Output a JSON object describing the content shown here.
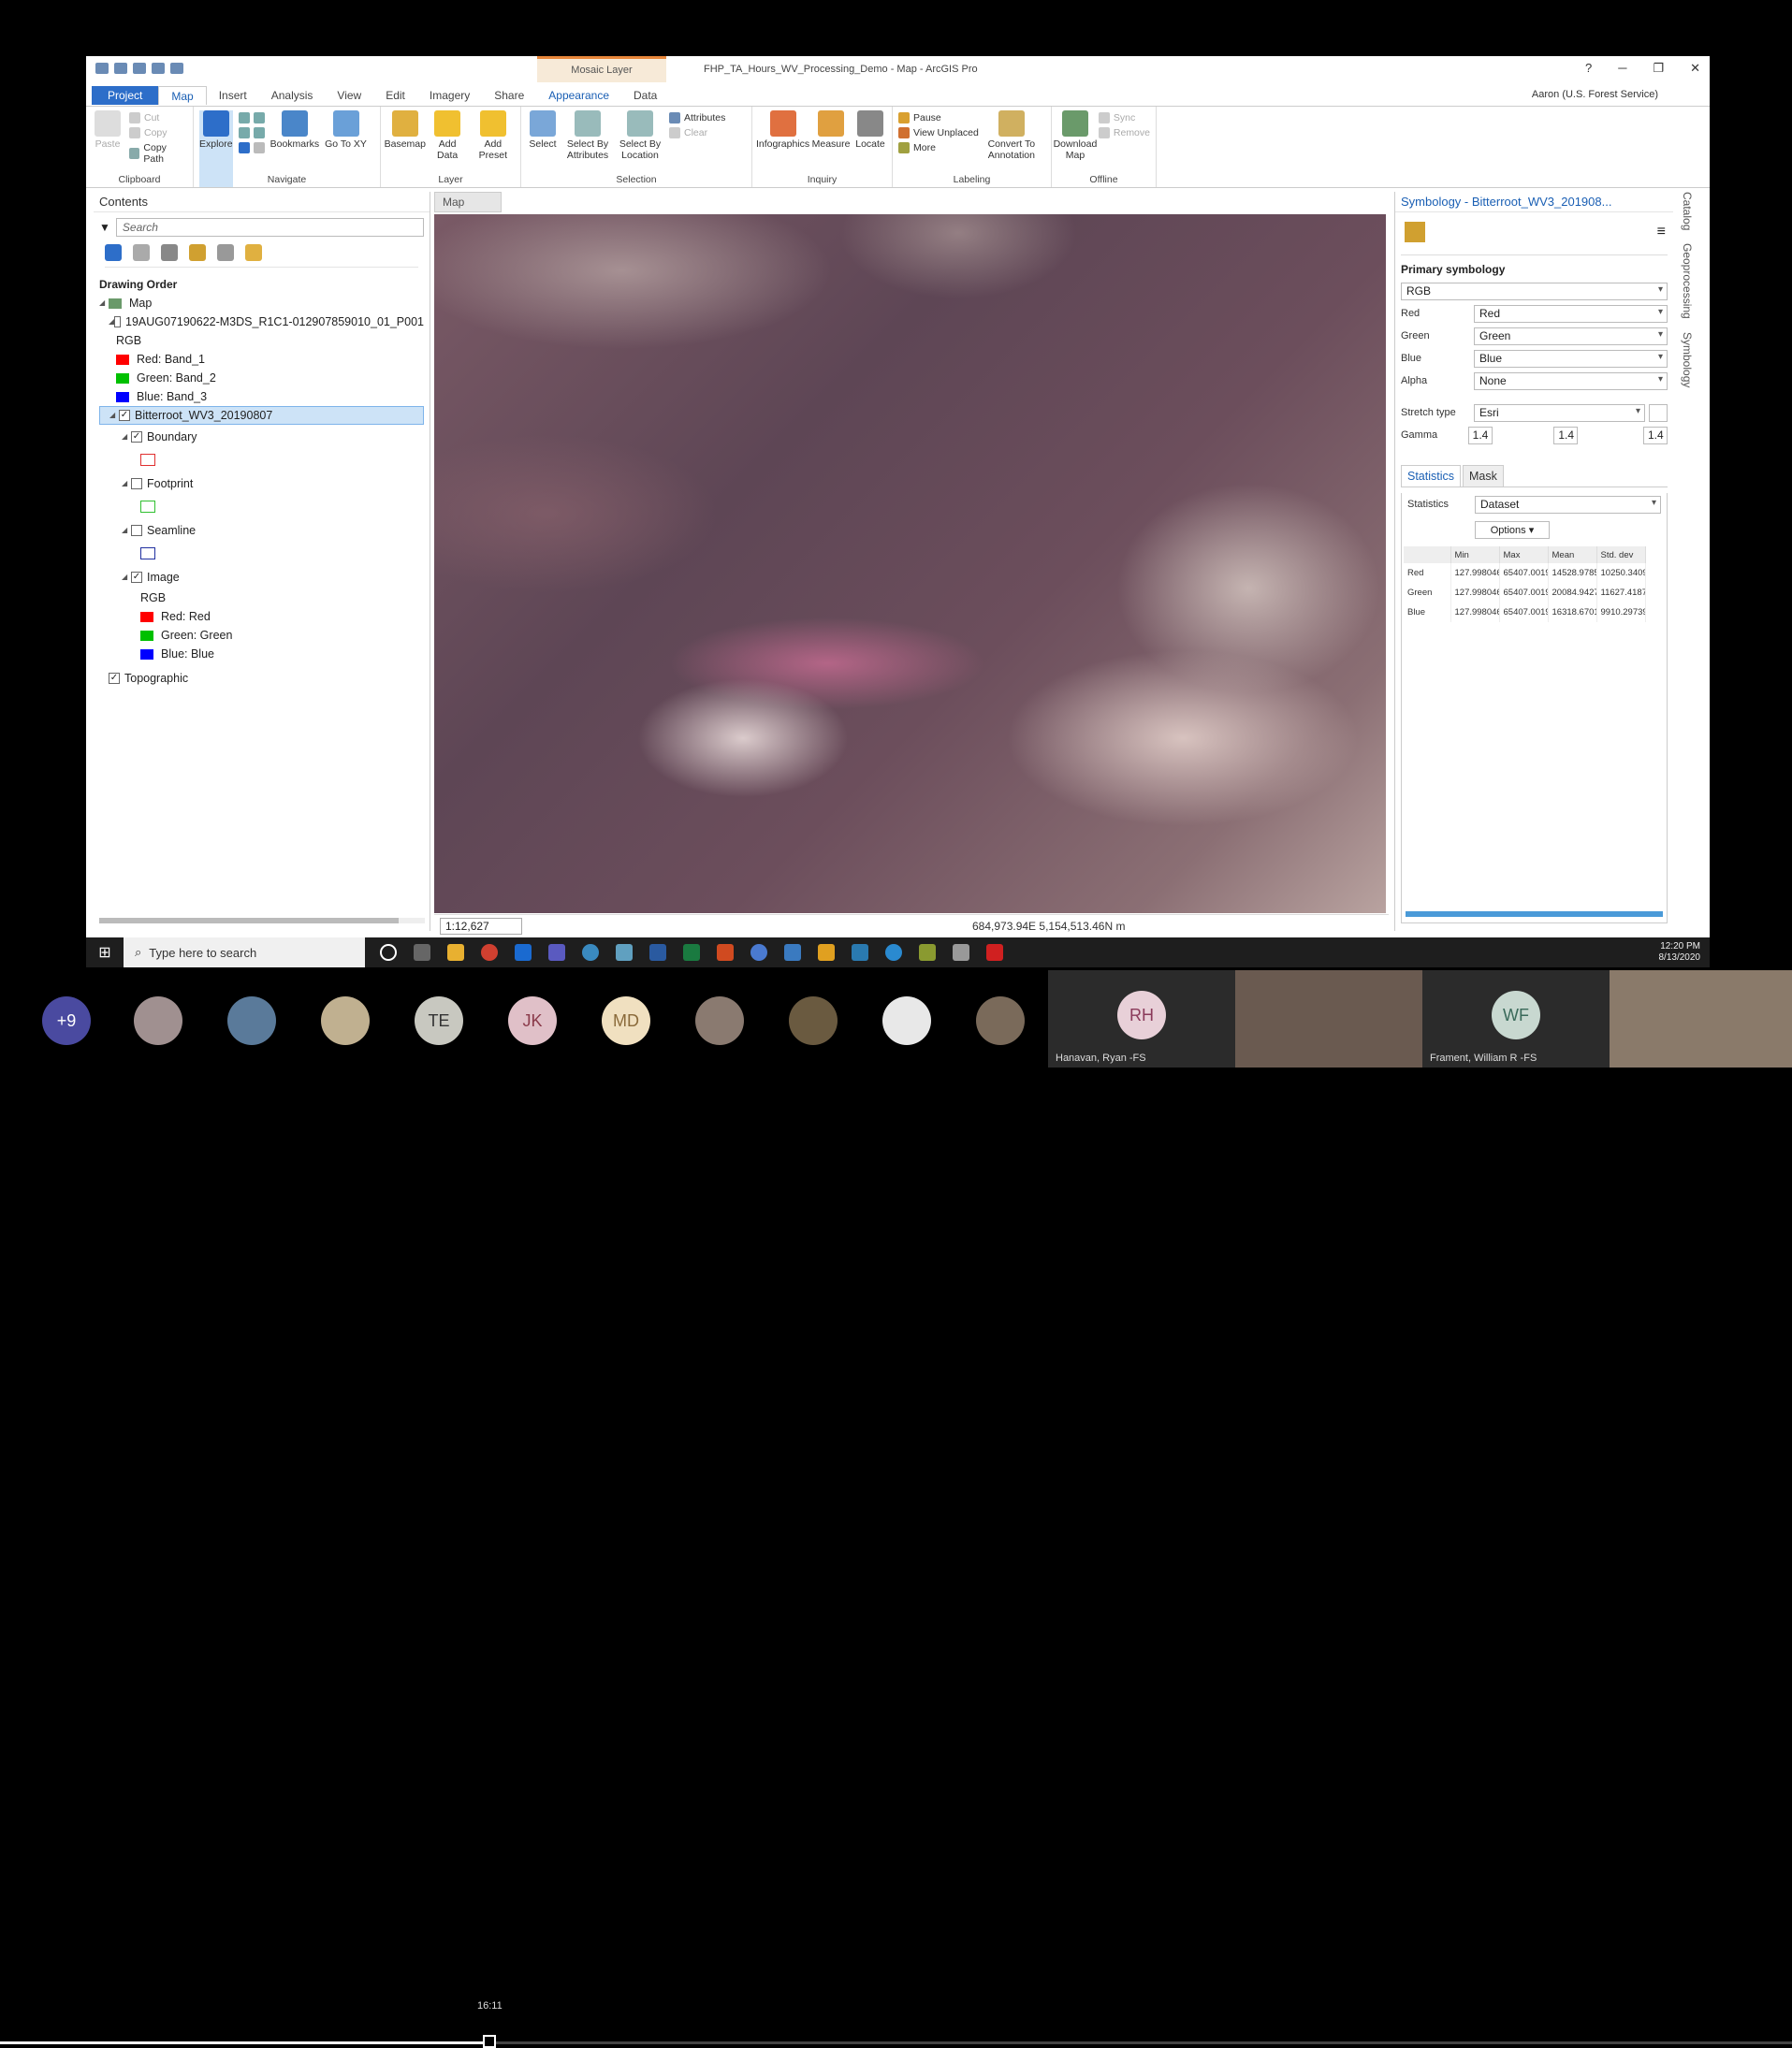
{
  "app": {
    "qat_icons": [
      "new-icon",
      "open-icon",
      "save-icon",
      "undo-icon",
      "redo-icon"
    ],
    "context_tab": "Mosaic Layer",
    "title": "FHP_TA_Hours_WV_Processing_Demo - Map - ArcGIS Pro",
    "help": "?",
    "user": "Aaron (U.S. Forest Service)"
  },
  "tabs": [
    "Project",
    "Map",
    "Insert",
    "Analysis",
    "View",
    "Edit",
    "Imagery",
    "Share",
    "Appearance",
    "Data"
  ],
  "ribbon": {
    "clipboard": {
      "label": "Clipboard",
      "paste": "Paste",
      "cut": "Cut",
      "copy": "Copy",
      "copy_path": "Copy Path"
    },
    "navigate": {
      "label": "Navigate",
      "explore": "Explore",
      "bookmarks": "Bookmarks",
      "goto": "Go To XY"
    },
    "layer": {
      "label": "Layer",
      "basemap": "Basemap",
      "add_data": "Add Data",
      "add_preset": "Add Preset"
    },
    "selection": {
      "label": "Selection",
      "select": "Select",
      "by_attr": "Select By Attributes",
      "by_loc": "Select By Location",
      "attributes": "Attributes",
      "clear": "Clear"
    },
    "inquiry": {
      "label": "Inquiry",
      "infographics": "Infographics",
      "measure": "Measure",
      "locate": "Locate"
    },
    "labeling": {
      "label": "Labeling",
      "pause": "Pause",
      "view_unplaced": "View Unplaced",
      "more": "More",
      "convert": "Convert To Annotation"
    },
    "offline": {
      "label": "Offline",
      "download": "Download Map",
      "sync": "Sync",
      "remove": "Remove"
    }
  },
  "contents": {
    "title": "Contents",
    "search_placeholder": "Search",
    "drawing_order": "Drawing Order",
    "map": "Map",
    "layer1": "19AUG07190622-M3DS_R1C1-012907859010_01_P001",
    "rgb": "RGB",
    "red1": "Red:  Band_1",
    "green1": "Green: Band_2",
    "blue1": "Blue:  Band_3",
    "layer2": "Bitterroot_WV3_20190807",
    "boundary": "Boundary",
    "footprint": "Footprint",
    "seamline": "Seamline",
    "image": "Image",
    "rgb2": "RGB",
    "red2": "Red:  Red",
    "green2": "Green: Green",
    "blue2": "Blue:  Blue",
    "topographic": "Topographic"
  },
  "map": {
    "tab": "Map",
    "scale": "1:12,627",
    "coords": "684,973.94E 5,154,513.46N m"
  },
  "symbology": {
    "title": "Symbology - Bitterroot_WV3_201908...",
    "primary": "Primary symbology",
    "renderer": "RGB",
    "red_label": "Red",
    "red": "Red",
    "green_label": "Green",
    "green": "Green",
    "blue_label": "Blue",
    "blue": "Blue",
    "alpha_label": "Alpha",
    "alpha": "None",
    "stretch_label": "Stretch type",
    "stretch": "Esri",
    "gamma_label": "Gamma",
    "gamma": [
      "1.4",
      "1.4",
      "1.4"
    ],
    "tab_stats": "Statistics",
    "tab_mask": "Mask",
    "stats_label": "Statistics",
    "stats_value": "Dataset",
    "options": "Options",
    "columns": [
      "",
      "Min",
      "Max",
      "Mean",
      "Std. dev"
    ],
    "rows": [
      [
        "Red",
        "127.998046",
        "65407.0019",
        "14528.9785",
        "10250.3409"
      ],
      [
        "Green",
        "127.998046",
        "65407.0019",
        "20084.9427",
        "11627.4187"
      ],
      [
        "Blue",
        "127.998046",
        "65407.0019",
        "16318.6701",
        "9910.29739"
      ]
    ]
  },
  "sidetabs": [
    "Catalog",
    "Geoprocessing",
    "Symbology"
  ],
  "taskbar": {
    "search": "Type here to search",
    "time": "12:20 PM",
    "date": "8/13/2020"
  },
  "meeting": {
    "more": "+9",
    "initials": [
      "TE",
      "JK",
      "MD",
      "RH",
      "WF"
    ],
    "clock": "16:11",
    "name1": "Hanavan, Ryan -FS",
    "name2": "Frament, William R -FS"
  }
}
